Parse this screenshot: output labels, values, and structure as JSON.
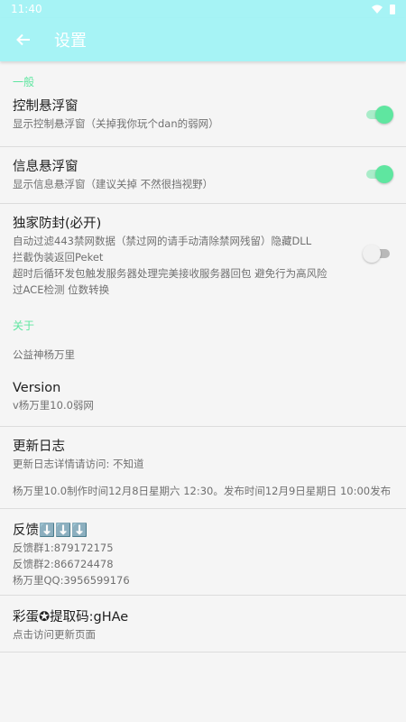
{
  "status_bar": {
    "time": "11:40"
  },
  "app_bar": {
    "title": "设置"
  },
  "sections": {
    "general": "一般",
    "about": "关于"
  },
  "prefs": {
    "floating_control": {
      "title": "控制悬浮窗",
      "summary": "显示控制悬浮窗（关掉我你玩个dan的弱网）",
      "enabled": true
    },
    "floating_info": {
      "title": "信息悬浮窗",
      "summary": "显示信息悬浮窗（建议关掉 不然很挡视野）",
      "enabled": true
    },
    "anti_ban": {
      "title": "独家防封(必开)",
      "summary_lines": [
        "自动过滤443禁网数据（禁过网的请手动清除禁网残留）隐藏DLL",
        "拦截伪装返回Peket",
        "超时后循环发包触发服务器处理完美接收服务器回包 避免行为高风险",
        "过ACE检测 位数转换"
      ],
      "enabled": false
    },
    "author": {
      "summary": "公益神杨万里"
    },
    "version": {
      "title": "Version",
      "summary": "v杨万里10.0弱网"
    },
    "changelog": {
      "title": "更新日志",
      "summary": "更新日志详情请访问: 不知道",
      "detail": "杨万里10.0制作时间12月8日星期六 12:30。发布时间12月9日星期日 10:00发布"
    },
    "feedback": {
      "title": "反馈⬇️⬇️⬇️",
      "lines": [
        "反馈群1:879172175",
        "反馈群2:866724478",
        "杨万里QQ:3956599176"
      ]
    },
    "easter_egg": {
      "title": "彩蛋✪提取码:gHAe",
      "summary": "点击访问更新页面"
    }
  },
  "colors": {
    "app_bar": "#a6f3f5",
    "accent": "#5fe6a0",
    "background": "#f5f5f5"
  }
}
